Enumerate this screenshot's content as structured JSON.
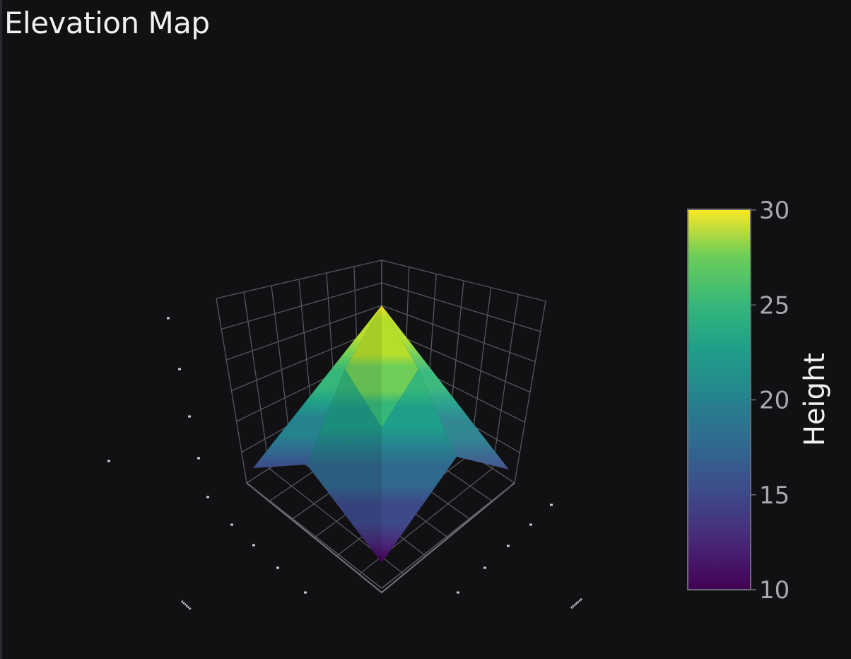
{
  "page": {
    "title": "Elevation Map"
  },
  "chart_data": {
    "type": "surface3d",
    "title": "Elevation Map",
    "surface": {
      "shape": "pyramid",
      "peak_height": 29.5,
      "corner_height": 14,
      "near_corner_height": 11.5,
      "colorscale": "Viridis"
    },
    "colorbar": {
      "title": "Height",
      "range": [
        10,
        30
      ],
      "ticks": [
        "10",
        "15",
        "20",
        "25",
        "30"
      ]
    },
    "grid": true,
    "colors": {
      "background": "#111114",
      "grid": "#55565c",
      "text": "#f1f1f3",
      "tick": "#a8a8ae"
    }
  }
}
